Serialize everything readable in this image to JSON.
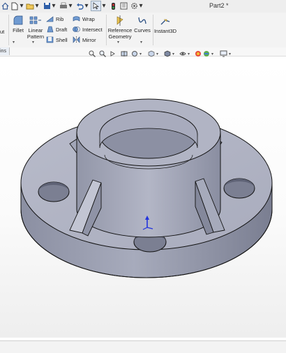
{
  "title_bar": {
    "document_title": "Part2 *",
    "quick_access": [
      {
        "name": "home-icon"
      },
      {
        "name": "new-document-icon"
      },
      {
        "name": "open-icon"
      },
      {
        "name": "save-icon"
      },
      {
        "name": "print-icon"
      },
      {
        "name": "undo-icon"
      },
      {
        "name": "select-pointer-icon"
      },
      {
        "name": "rebuild-icon"
      },
      {
        "name": "file-properties-icon"
      },
      {
        "name": "options-gear-icon"
      }
    ]
  },
  "ribbon": {
    "cut_partial": "ut",
    "fillet": "Fillet",
    "linear_pattern": "Linear\nPattern",
    "rib": "Rib",
    "draft": "Draft",
    "shell": "Shell",
    "wrap": "Wrap",
    "intersect": "Intersect",
    "mirror": "Mirror",
    "reference_geometry": "Reference\nGeometry",
    "curves": "Curves",
    "instant3d": "Instant3D"
  },
  "tabs": {
    "active_partial": "ins"
  },
  "colors": {
    "part_face_light": "#b9bccb",
    "part_face_mid": "#9ea2b3",
    "part_face_dark": "#7d8194",
    "edge": "#111111",
    "triad_z": "#2233dd"
  }
}
